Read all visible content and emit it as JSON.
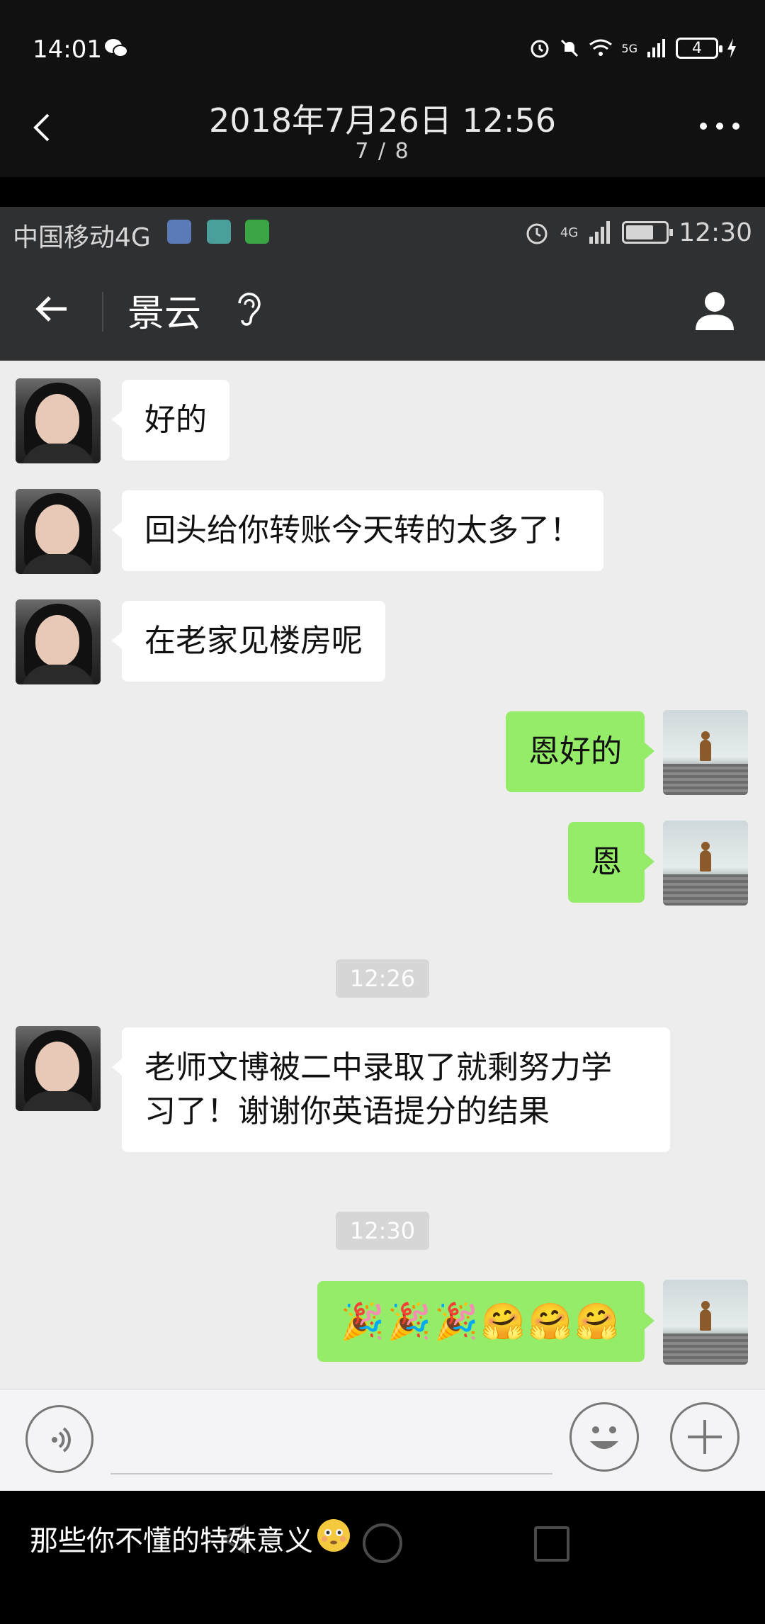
{
  "outer_status": {
    "time": "14:01",
    "battery": "4",
    "network": "5G"
  },
  "viewer": {
    "title": "2018年7月26日 12:56",
    "page": "7 / 8"
  },
  "inner_status": {
    "carrier": "中国移动4G",
    "network": "4G",
    "time": "12:30"
  },
  "chat": {
    "contact_name": "景云",
    "messages": [
      {
        "side": "left",
        "text": "好的"
      },
      {
        "side": "left",
        "text": "回头给你转账今天转的太多了！"
      },
      {
        "side": "left",
        "text": "在老家见楼房呢"
      },
      {
        "side": "right",
        "text": "恩好的"
      },
      {
        "side": "right",
        "text": "恩"
      },
      {
        "type": "timestamp",
        "text": "12:26"
      },
      {
        "side": "left",
        "line1": "老师文博被二中录取了就剩努力学",
        "line2": "习了！谢谢你英语提分的结果"
      },
      {
        "type": "timestamp",
        "text": "12:30"
      },
      {
        "side": "right",
        "text": "🎉🎉🎉🤗🤗🤗"
      }
    ]
  },
  "caption": {
    "text": "那些你不懂的特殊意义"
  },
  "colors": {
    "bubble_right": "#95ec69",
    "bubble_left": "#ffffff",
    "header_bg": "#2f3032",
    "chat_bg": "#ededed"
  }
}
